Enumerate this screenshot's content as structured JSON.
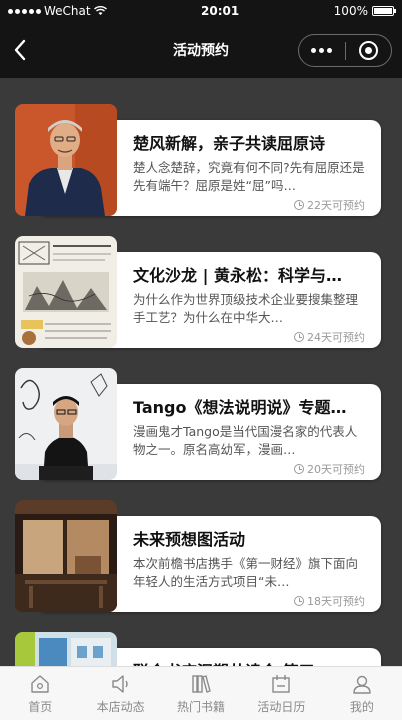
{
  "status_bar": {
    "carrier": "WeChat",
    "time": "20:01",
    "battery": "100%",
    "battery_level": 1.0
  },
  "nav": {
    "title": "活动预约"
  },
  "events": [
    {
      "title": "楚风新解，亲子共读屈原诗",
      "desc": "楚人念楚辞，究竟有何不同?先有屈原还是先有端午？屈原是姓“屈”吗…",
      "meta": "22天可预约"
    },
    {
      "title": "文化沙龙 | 黄永松：科学与…",
      "desc": "为什么作为世界顶级技术企业要搜集整理手工艺？为什么在中华大…",
      "meta": "24天可预约"
    },
    {
      "title": "Tango《想法说明说》专题…",
      "desc": "漫画鬼才Tango是当代国漫名家的代表人物之一。原名高幼军，漫画…",
      "meta": "20天可预约"
    },
    {
      "title": "未来预想图活动",
      "desc": "本次前檐书店携手《第一财经》旗下面向年轻人的生活方式项目“未…",
      "meta": "18天可预约"
    },
    {
      "title": "联合书店泥塑共读会 第五…",
      "desc": "",
      "meta": ""
    }
  ],
  "tabs": [
    {
      "label": "首页",
      "icon": "home-icon"
    },
    {
      "label": "本店动态",
      "icon": "speaker-icon"
    },
    {
      "label": "热门书籍",
      "icon": "books-icon"
    },
    {
      "label": "活动日历",
      "icon": "calendar-icon"
    },
    {
      "label": "我的",
      "icon": "user-icon"
    }
  ]
}
